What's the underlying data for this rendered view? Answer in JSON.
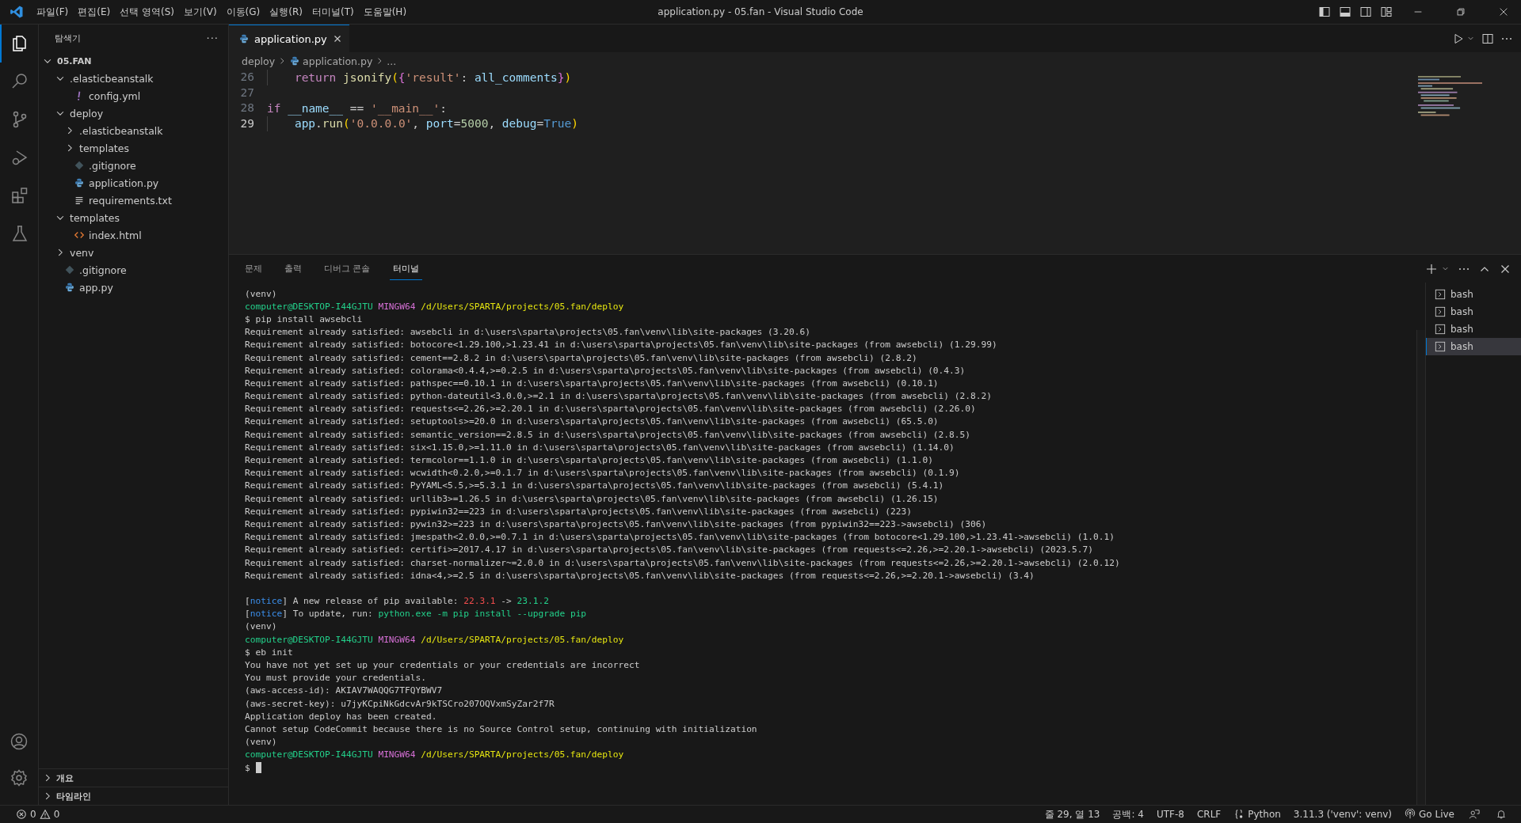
{
  "window": {
    "title": "application.py - 05.fan - Visual Studio Code"
  },
  "menu": [
    "파일(F)",
    "편집(E)",
    "선택 영역(S)",
    "보기(V)",
    "이동(G)",
    "실행(R)",
    "터미널(T)",
    "도움말(H)"
  ],
  "activity_bar": [
    {
      "kind": "files",
      "selected": true
    },
    {
      "kind": "search",
      "selected": false
    },
    {
      "kind": "scm",
      "selected": false
    },
    {
      "kind": "debug",
      "selected": false
    },
    {
      "kind": "extensions",
      "selected": false
    },
    {
      "kind": "testing",
      "selected": false
    }
  ],
  "sidebar": {
    "title": "탐색기",
    "more": "···",
    "root": {
      "label": "05.FAN",
      "expanded": true,
      "children": [
        {
          "label": ".elasticbeanstalk",
          "kind": "folder",
          "expanded": true,
          "children": [
            {
              "label": "config.yml",
              "kind": "yaml"
            }
          ]
        },
        {
          "label": "deploy",
          "kind": "folder",
          "expanded": true,
          "children": [
            {
              "label": ".elasticbeanstalk",
              "kind": "folder",
              "expanded": false
            },
            {
              "label": "templates",
              "kind": "folder",
              "expanded": false
            },
            {
              "label": ".gitignore",
              "kind": "git"
            },
            {
              "label": "application.py",
              "kind": "python"
            },
            {
              "label": "requirements.txt",
              "kind": "text"
            }
          ]
        },
        {
          "label": "templates",
          "kind": "folder",
          "expanded": true,
          "children": [
            {
              "label": "index.html",
              "kind": "html"
            }
          ]
        },
        {
          "label": "venv",
          "kind": "folder",
          "expanded": false
        },
        {
          "label": ".gitignore",
          "kind": "git"
        },
        {
          "label": "app.py",
          "kind": "python"
        }
      ]
    },
    "sections": [
      {
        "label": "개요",
        "expanded": false
      },
      {
        "label": "타임라인",
        "expanded": false
      }
    ]
  },
  "editor": {
    "tabs": [
      {
        "label": "application.py",
        "selected": true
      }
    ],
    "breadcrumb": [
      "deploy",
      "application.py",
      "..."
    ],
    "lines": [
      {
        "number": "26",
        "indented": true,
        "active": false,
        "tokens": [
          {
            "text": "return",
            "kind": "keyword"
          },
          {
            "text": "jsonify",
            "kind": "func",
            "space": true
          },
          {
            "text": "(",
            "kind": "b1"
          },
          {
            "text": "{",
            "kind": "b2"
          },
          {
            "text": "'result'",
            "kind": "string"
          },
          {
            "text": ":",
            "kind": "plain"
          },
          {
            "text": "all_comments",
            "kind": "var",
            "space": true
          },
          {
            "text": "}",
            "kind": "b2"
          },
          {
            "text": ")",
            "kind": "b1"
          }
        ]
      },
      {
        "number": "27",
        "indented": false,
        "active": false
      },
      {
        "number": "28",
        "indented": false,
        "active": false,
        "tokens": [
          {
            "text": "if",
            "kind": "keyword"
          },
          {
            "text": "__name__",
            "kind": "var",
            "space": true
          },
          {
            "text": "==",
            "kind": "plain",
            "space": true
          },
          {
            "text": "'__main__'",
            "kind": "string",
            "space": true
          },
          {
            "text": ":",
            "kind": "plain"
          }
        ]
      },
      {
        "number": "29",
        "indented": true,
        "active": true,
        "tokens": [
          {
            "text": "app",
            "kind": "var"
          },
          {
            "text": ".",
            "kind": "plain"
          },
          {
            "text": "run",
            "kind": "func"
          },
          {
            "text": "(",
            "kind": "b1"
          },
          {
            "text": "'0.0.0.0'",
            "kind": "string"
          },
          {
            "text": ",",
            "kind": "plain"
          },
          {
            "text": "port",
            "kind": "var",
            "space": true
          },
          {
            "text": "=",
            "kind": "plain"
          },
          {
            "text": "5000",
            "kind": "number"
          },
          {
            "text": ",",
            "kind": "plain"
          },
          {
            "text": "debug",
            "kind": "var",
            "space": true
          },
          {
            "text": "=",
            "kind": "plain"
          },
          {
            "text": "True",
            "kind": "const"
          },
          {
            "text": ")",
            "kind": "b1"
          }
        ]
      }
    ]
  },
  "panel": {
    "tabs": [
      {
        "label": "문제",
        "selected": false
      },
      {
        "label": "출력",
        "selected": false
      },
      {
        "label": "디버그 콘솔",
        "selected": false
      },
      {
        "label": "터미널",
        "selected": true
      }
    ],
    "terminal_blocks": [
      {
        "lines": [
          {
            "segments": [
              {
                "text": "(venv)",
                "kind": "plain"
              }
            ]
          },
          {
            "segments": [
              {
                "text": "computer@DESKTOP-I44GJTU",
                "kind": "user"
              },
              {
                "text": "MINGW64",
                "kind": "host"
              },
              {
                "text": "/d/Users/SPARTA/projects/05.fan/deploy",
                "kind": "path"
              }
            ]
          },
          {
            "segments": [
              {
                "text": "$ pip install awsebcli",
                "kind": "plain"
              }
            ]
          },
          {
            "segments": [
              {
                "text": "Requirement already satisfied: awsebcli in d:\\users\\sparta\\projects\\05.fan\\venv\\lib\\site-packages (3.20.6)",
                "kind": "plain"
              }
            ]
          },
          {
            "segments": [
              {
                "text": "Requirement already satisfied: botocore<1.29.100,>1.23.41 in d:\\users\\sparta\\projects\\05.fan\\venv\\lib\\site-packages (from awsebcli) (1.29.99)",
                "kind": "plain"
              }
            ]
          },
          {
            "segments": [
              {
                "text": "Requirement already satisfied: cement==2.8.2 in d:\\users\\sparta\\projects\\05.fan\\venv\\lib\\site-packages (from awsebcli) (2.8.2)",
                "kind": "plain"
              }
            ]
          },
          {
            "segments": [
              {
                "text": "Requirement already satisfied: colorama<0.4.4,>=0.2.5 in d:\\users\\sparta\\projects\\05.fan\\venv\\lib\\site-packages (from awsebcli) (0.4.3)",
                "kind": "plain"
              }
            ]
          },
          {
            "segments": [
              {
                "text": "Requirement already satisfied: pathspec==0.10.1 in d:\\users\\sparta\\projects\\05.fan\\venv\\lib\\site-packages (from awsebcli) (0.10.1)",
                "kind": "plain"
              }
            ]
          },
          {
            "segments": [
              {
                "text": "Requirement already satisfied: python-dateutil<3.0.0,>=2.1 in d:\\users\\sparta\\projects\\05.fan\\venv\\lib\\site-packages (from awsebcli) (2.8.2)",
                "kind": "plain"
              }
            ]
          },
          {
            "segments": [
              {
                "text": "Requirement already satisfied: requests<=2.26,>=2.20.1 in d:\\users\\sparta\\projects\\05.fan\\venv\\lib\\site-packages (from awsebcli) (2.26.0)",
                "kind": "plain"
              }
            ]
          },
          {
            "segments": [
              {
                "text": "Requirement already satisfied: setuptools>=20.0 in d:\\users\\sparta\\projects\\05.fan\\venv\\lib\\site-packages (from awsebcli) (65.5.0)",
                "kind": "plain"
              }
            ]
          },
          {
            "segments": [
              {
                "text": "Requirement already satisfied: semantic_version==2.8.5 in d:\\users\\sparta\\projects\\05.fan\\venv\\lib\\site-packages (from awsebcli) (2.8.5)",
                "kind": "plain"
              }
            ]
          },
          {
            "segments": [
              {
                "text": "Requirement already satisfied: six<1.15.0,>=1.11.0 in d:\\users\\sparta\\projects\\05.fan\\venv\\lib\\site-packages (from awsebcli) (1.14.0)",
                "kind": "plain"
              }
            ]
          },
          {
            "segments": [
              {
                "text": "Requirement already satisfied: termcolor==1.1.0 in d:\\users\\sparta\\projects\\05.fan\\venv\\lib\\site-packages (from awsebcli) (1.1.0)",
                "kind": "plain"
              }
            ]
          },
          {
            "segments": [
              {
                "text": "Requirement already satisfied: wcwidth<0.2.0,>=0.1.7 in d:\\users\\sparta\\projects\\05.fan\\venv\\lib\\site-packages (from awsebcli) (0.1.9)",
                "kind": "plain"
              }
            ]
          },
          {
            "segments": [
              {
                "text": "Requirement already satisfied: PyYAML<5.5,>=5.3.1 in d:\\users\\sparta\\projects\\05.fan\\venv\\lib\\site-packages (from awsebcli) (5.4.1)",
                "kind": "plain"
              }
            ]
          },
          {
            "segments": [
              {
                "text": "Requirement already satisfied: urllib3>=1.26.5 in d:\\users\\sparta\\projects\\05.fan\\venv\\lib\\site-packages (from awsebcli) (1.26.15)",
                "kind": "plain"
              }
            ]
          },
          {
            "segments": [
              {
                "text": "Requirement already satisfied: pypiwin32==223 in d:\\users\\sparta\\projects\\05.fan\\venv\\lib\\site-packages (from awsebcli) (223)",
                "kind": "plain"
              }
            ]
          },
          {
            "segments": [
              {
                "text": "Requirement already satisfied: pywin32>=223 in d:\\users\\sparta\\projects\\05.fan\\venv\\lib\\site-packages (from pypiwin32==223->awsebcli) (306)",
                "kind": "plain"
              }
            ]
          },
          {
            "segments": [
              {
                "text": "Requirement already satisfied: jmespath<2.0.0,>=0.7.1 in d:\\users\\sparta\\projects\\05.fan\\venv\\lib\\site-packages (from botocore<1.29.100,>1.23.41->awsebcli) (1.0.1)",
                "kind": "plain"
              }
            ]
          },
          {
            "segments": [
              {
                "text": "Requirement already satisfied: certifi>=2017.4.17 in d:\\users\\sparta\\projects\\05.fan\\venv\\lib\\site-packages (from requests<=2.26,>=2.20.1->awsebcli) (2023.5.7)",
                "kind": "plain"
              }
            ]
          },
          {
            "segments": [
              {
                "text": "Requirement already satisfied: charset-normalizer~=2.0.0 in d:\\users\\sparta\\projects\\05.fan\\venv\\lib\\site-packages (from requests<=2.26,>=2.20.1->awsebcli) (2.0.12)",
                "kind": "plain"
              }
            ]
          },
          {
            "segments": [
              {
                "text": "Requirement already satisfied: idna<4,>=2.5 in d:\\users\\sparta\\projects\\05.fan\\venv\\lib\\site-packages (from requests<=2.26,>=2.20.1->awsebcli) (3.4)",
                "kind": "plain"
              }
            ]
          }
        ]
      },
      {
        "lines": [
          {
            "segments": [
              {
                "text": "[",
                "kind": "plain"
              },
              {
                "text": "notice",
                "kind": "notice"
              },
              {
                "text": "] A new release of pip available:",
                "kind": "plain"
              },
              {
                "text": "22.3.1",
                "kind": "red",
                "space": true
              },
              {
                "text": "->",
                "kind": "plain",
                "space": true
              },
              {
                "text": "23.1.2",
                "kind": "green",
                "space": true
              }
            ]
          },
          {
            "segments": [
              {
                "text": "[",
                "kind": "plain"
              },
              {
                "text": "notice",
                "kind": "notice"
              },
              {
                "text": "] To update, run:",
                "kind": "plain"
              },
              {
                "text": "python.exe -m pip install --upgrade pip",
                "kind": "green",
                "space": true
              }
            ]
          },
          {
            "segments": [
              {
                "text": "(venv)",
                "kind": "plain"
              }
            ]
          },
          {
            "segments": [
              {
                "text": "computer@DESKTOP-I44GJTU",
                "kind": "user"
              },
              {
                "text": "MINGW64",
                "kind": "host"
              },
              {
                "text": "/d/Users/SPARTA/projects/05.fan/deploy",
                "kind": "path"
              }
            ]
          },
          {
            "segments": [
              {
                "text": "$ eb init",
                "kind": "plain"
              }
            ]
          },
          {
            "segments": [
              {
                "text": "You have not yet set up your credentials or your credentials are incorrect",
                "kind": "plain"
              }
            ]
          },
          {
            "segments": [
              {
                "text": "You must provide your credentials.",
                "kind": "plain"
              }
            ]
          },
          {
            "segments": [
              {
                "text": "(aws-access-id): AKIAV7WAQQG7TFQYBWV7",
                "kind": "plain"
              }
            ]
          },
          {
            "segments": [
              {
                "text": "(aws-secret-key): u7jyKCpiNkGdcvAr9kTSCro207OQVxmSyZar2f7R",
                "kind": "plain"
              }
            ]
          },
          {
            "segments": [
              {
                "text": "Application deploy has been created.",
                "kind": "plain"
              }
            ]
          },
          {
            "segments": [
              {
                "text": "Cannot setup CodeCommit because there is no Source Control setup, continuing with initialization",
                "kind": "plain"
              }
            ]
          },
          {
            "segments": [
              {
                "text": "(venv)",
                "kind": "plain"
              }
            ]
          },
          {
            "segments": [
              {
                "text": "computer@DESKTOP-I44GJTU",
                "kind": "user"
              },
              {
                "text": "MINGW64",
                "kind": "host"
              },
              {
                "text": "/d/Users/SPARTA/projects/05.fan/deploy",
                "kind": "path"
              }
            ]
          },
          {
            "segments": [
              {
                "text": "$",
                "kind": "plain"
              }
            ],
            "cursor": true
          }
        ]
      }
    ],
    "terminals": [
      {
        "label": "bash",
        "selected": false
      },
      {
        "label": "bash",
        "selected": false
      },
      {
        "label": "bash",
        "selected": false
      },
      {
        "label": "bash",
        "selected": true
      }
    ]
  },
  "status_bar": {
    "errors": "0",
    "warnings": "0",
    "items": [
      {
        "label": "줄 29, 열 13",
        "kind": "text"
      },
      {
        "label": "공백: 4",
        "kind": "text"
      },
      {
        "label": "UTF-8",
        "kind": "text"
      },
      {
        "label": "CRLF",
        "kind": "text"
      },
      {
        "label": "Python",
        "kind": "language"
      },
      {
        "label": "3.11.3 ('venv': venv)",
        "kind": "text"
      },
      {
        "label": "Go Live",
        "kind": "live"
      }
    ]
  }
}
